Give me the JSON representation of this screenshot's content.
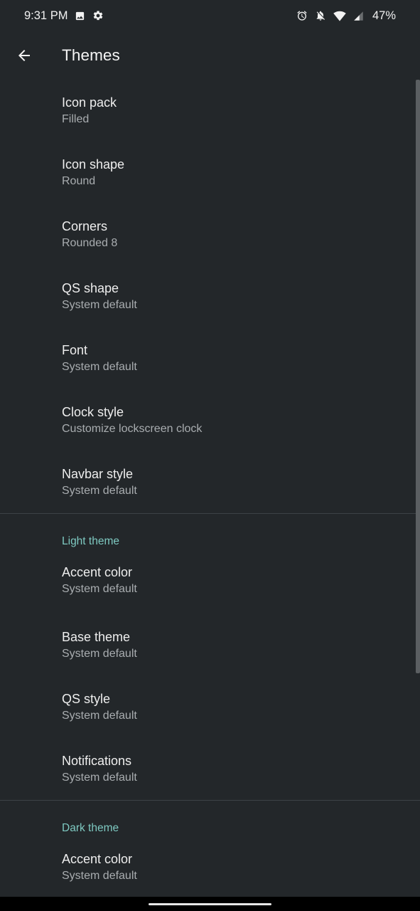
{
  "status_bar": {
    "time": "9:31 PM",
    "battery": "47%",
    "icons_left": [
      "image-icon",
      "gear-icon"
    ],
    "icons_right": [
      "alarm-icon",
      "notifications-off-icon",
      "wifi-icon",
      "signal-icon"
    ]
  },
  "header": {
    "title": "Themes",
    "back_icon": "arrow-back-icon"
  },
  "colors": {
    "background": "#23272a",
    "accent": "#7ec9c1",
    "summary_text": "#a9adb0"
  },
  "general_items": [
    {
      "title": "Icon pack",
      "summary": "Filled"
    },
    {
      "title": "Icon shape",
      "summary": "Round"
    },
    {
      "title": "Corners",
      "summary": "Rounded 8"
    },
    {
      "title": "QS shape",
      "summary": "System default"
    },
    {
      "title": "Font",
      "summary": "System default"
    },
    {
      "title": "Clock style",
      "summary": "Customize lockscreen clock"
    },
    {
      "title": "Navbar style",
      "summary": "System default"
    }
  ],
  "light_theme": {
    "header": "Light theme",
    "items": [
      {
        "title": "Accent color",
        "summary": "System default"
      },
      {
        "title": "Base theme",
        "summary": "System default"
      },
      {
        "title": "QS style",
        "summary": "System default"
      },
      {
        "title": "Notifications",
        "summary": "System default"
      }
    ]
  },
  "dark_theme": {
    "header": "Dark theme",
    "items": [
      {
        "title": "Accent color",
        "summary": "System default"
      }
    ]
  }
}
